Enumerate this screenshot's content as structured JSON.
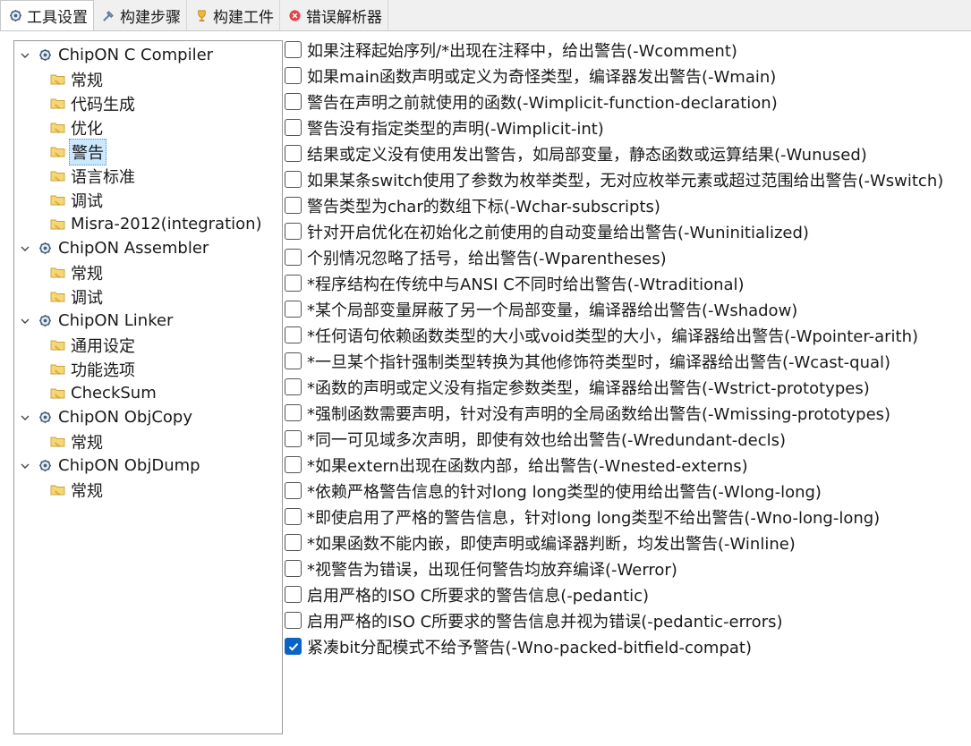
{
  "tabs": [
    {
      "label": "工具设置",
      "icon": "tool-settings-icon",
      "active": true
    },
    {
      "label": "构建步骤",
      "icon": "build-steps-icon",
      "active": false
    },
    {
      "label": "构建工件",
      "icon": "build-artifact-icon",
      "active": false
    },
    {
      "label": "错误解析器",
      "icon": "error-parser-icon",
      "active": false
    }
  ],
  "tree": [
    {
      "label": "ChipON C Compiler",
      "level": 0,
      "expanded": true
    },
    {
      "label": "常规",
      "level": 1
    },
    {
      "label": "代码生成",
      "level": 1
    },
    {
      "label": "优化",
      "level": 1
    },
    {
      "label": "警告",
      "level": 1,
      "selected": true
    },
    {
      "label": "语言标准",
      "level": 1
    },
    {
      "label": "调试",
      "level": 1
    },
    {
      "label": "Misra-2012(integration)",
      "level": 1
    },
    {
      "label": "ChipON Assembler",
      "level": 0,
      "expanded": true
    },
    {
      "label": "常规",
      "level": 1
    },
    {
      "label": "调试",
      "level": 1
    },
    {
      "label": "ChipON Linker",
      "level": 0,
      "expanded": true
    },
    {
      "label": "通用设定",
      "level": 1
    },
    {
      "label": "功能选项",
      "level": 1
    },
    {
      "label": "CheckSum",
      "level": 1
    },
    {
      "label": "ChipON ObjCopy",
      "level": 0,
      "expanded": true
    },
    {
      "label": "常规",
      "level": 1
    },
    {
      "label": "ChipON ObjDump",
      "level": 0,
      "expanded": true
    },
    {
      "label": "常规",
      "level": 1
    }
  ],
  "options": [
    {
      "label": "如果注释起始序列/*出现在注释中，给出警告(-Wcomment)",
      "checked": false
    },
    {
      "label": "如果main函数声明或定义为奇怪类型，编译器发出警告(-Wmain)",
      "checked": false
    },
    {
      "label": "警告在声明之前就使用的函数(-Wimplicit-function-declaration)",
      "checked": false
    },
    {
      "label": "警告没有指定类型的声明(-Wimplicit-int)",
      "checked": false
    },
    {
      "label": "结果或定义没有使用发出警告，如局部变量，静态函数或运算结果(-Wunused)",
      "checked": false
    },
    {
      "label": "如果某条switch使用了参数为枚举类型，无对应枚举元素或超过范围给出警告(-Wswitch)",
      "checked": false
    },
    {
      "label": "警告类型为char的数组下标(-Wchar-subscripts)",
      "checked": false
    },
    {
      "label": "针对开启优化在初始化之前使用的自动变量给出警告(-Wuninitialized)",
      "checked": false
    },
    {
      "label": "个别情况忽略了括号，给出警告(-Wparentheses)",
      "checked": false
    },
    {
      "label": "*程序结构在传统中与ANSI C不同时给出警告(-Wtraditional)",
      "checked": false
    },
    {
      "label": "*某个局部变量屏蔽了另一个局部变量，编译器给出警告(-Wshadow)",
      "checked": false
    },
    {
      "label": "*任何语句依赖函数类型的大小或void类型的大小，编译器给出警告(-Wpointer-arith)",
      "checked": false
    },
    {
      "label": "*一旦某个指针强制类型转换为其他修饰符类型时，编译器给出警告(-Wcast-qual)",
      "checked": false
    },
    {
      "label": "*函数的声明或定义没有指定参数类型，编译器给出警告(-Wstrict-prototypes)",
      "checked": false
    },
    {
      "label": "*强制函数需要声明，针对没有声明的全局函数给出警告(-Wmissing-prototypes)",
      "checked": false
    },
    {
      "label": "*同一可见域多次声明，即使有效也给出警告(-Wredundant-decls)",
      "checked": false
    },
    {
      "label": "*如果extern出现在函数内部，给出警告(-Wnested-externs)",
      "checked": false
    },
    {
      "label": "*依赖严格警告信息的针对long long类型的使用给出警告(-Wlong-long)",
      "checked": false
    },
    {
      "label": "*即使启用了严格的警告信息，针对long long类型不给出警告(-Wno-long-long)",
      "checked": false
    },
    {
      "label": "*如果函数不能内嵌，即使声明或编译器判断，均发出警告(-Winline)",
      "checked": false
    },
    {
      "label": "*视警告为错误，出现任何警告均放弃编译(-Werror)",
      "checked": false
    },
    {
      "label": "启用严格的ISO C所要求的警告信息(-pedantic)",
      "checked": false
    },
    {
      "label": "启用严格的ISO C所要求的警告信息并视为错误(-pedantic-errors)",
      "checked": false
    },
    {
      "label": "紧凑bit分配模式不给予警告(-Wno-packed-bitfield-compat)",
      "checked": true
    }
  ]
}
